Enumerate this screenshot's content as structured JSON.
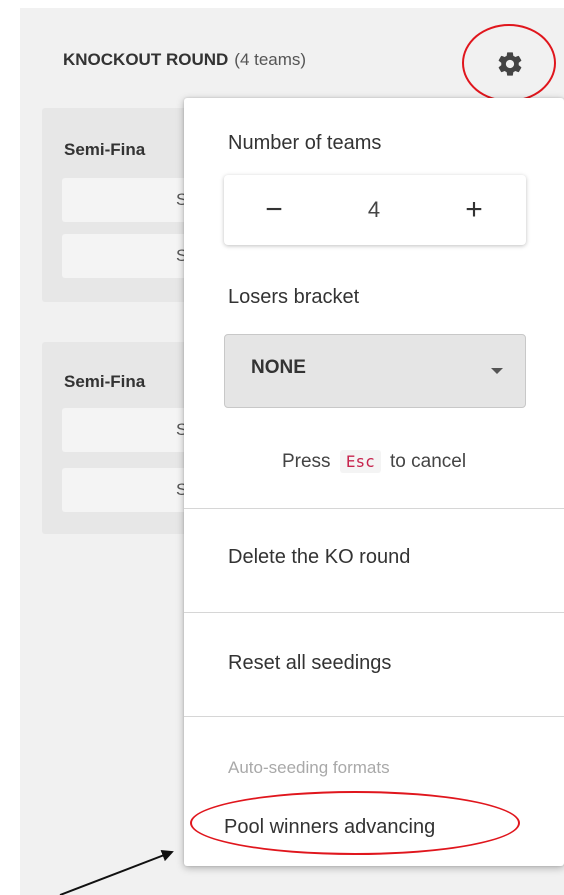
{
  "knockout": {
    "title": "KNOCKOUT ROUND",
    "team_count": "(4 teams)"
  },
  "matches": [
    {
      "title": "Semi-Fina",
      "slots": [
        "S",
        "S"
      ]
    },
    {
      "title": "Semi-Fina",
      "slots": [
        "S",
        "S"
      ]
    }
  ],
  "menu": {
    "number_of_teams_label": "Number of teams",
    "team_count_value": "4",
    "decrement_symbol": "−",
    "increment_symbol": "+",
    "losers_bracket_label": "Losers bracket",
    "losers_bracket_value": "NONE",
    "esc_hint_before": "Press",
    "esc_key": "Esc",
    "esc_hint_after": "to cancel",
    "delete_round": "Delete the KO round",
    "reset_seedings": "Reset all seedings",
    "auto_seeding_header": "Auto-seeding formats",
    "pool_winners": "Pool winners advancing"
  },
  "icons": {
    "settings": "gear-icon",
    "dropdown": "caret-down-icon"
  },
  "colors": {
    "annotation_red": "#e0161d",
    "esc_key_text": "#c7254e",
    "panel_background": "#f1f1f1"
  }
}
